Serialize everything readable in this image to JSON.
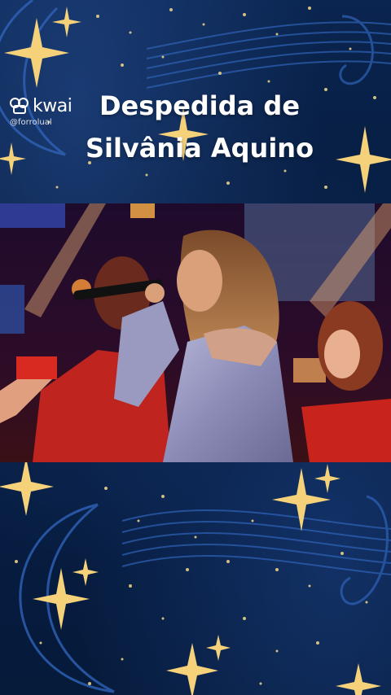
{
  "app": {
    "brand": "kwai",
    "handle": "@forrolual"
  },
  "title": {
    "line1": "Despedida de",
    "line2": "Silvânia Aquino"
  },
  "video": {
    "description_icon": "video-frame"
  },
  "colors": {
    "background": "#061a3a",
    "star": "#f5d27a",
    "title_text": "#ffffff",
    "moon_outline": "#2a5fb0"
  }
}
